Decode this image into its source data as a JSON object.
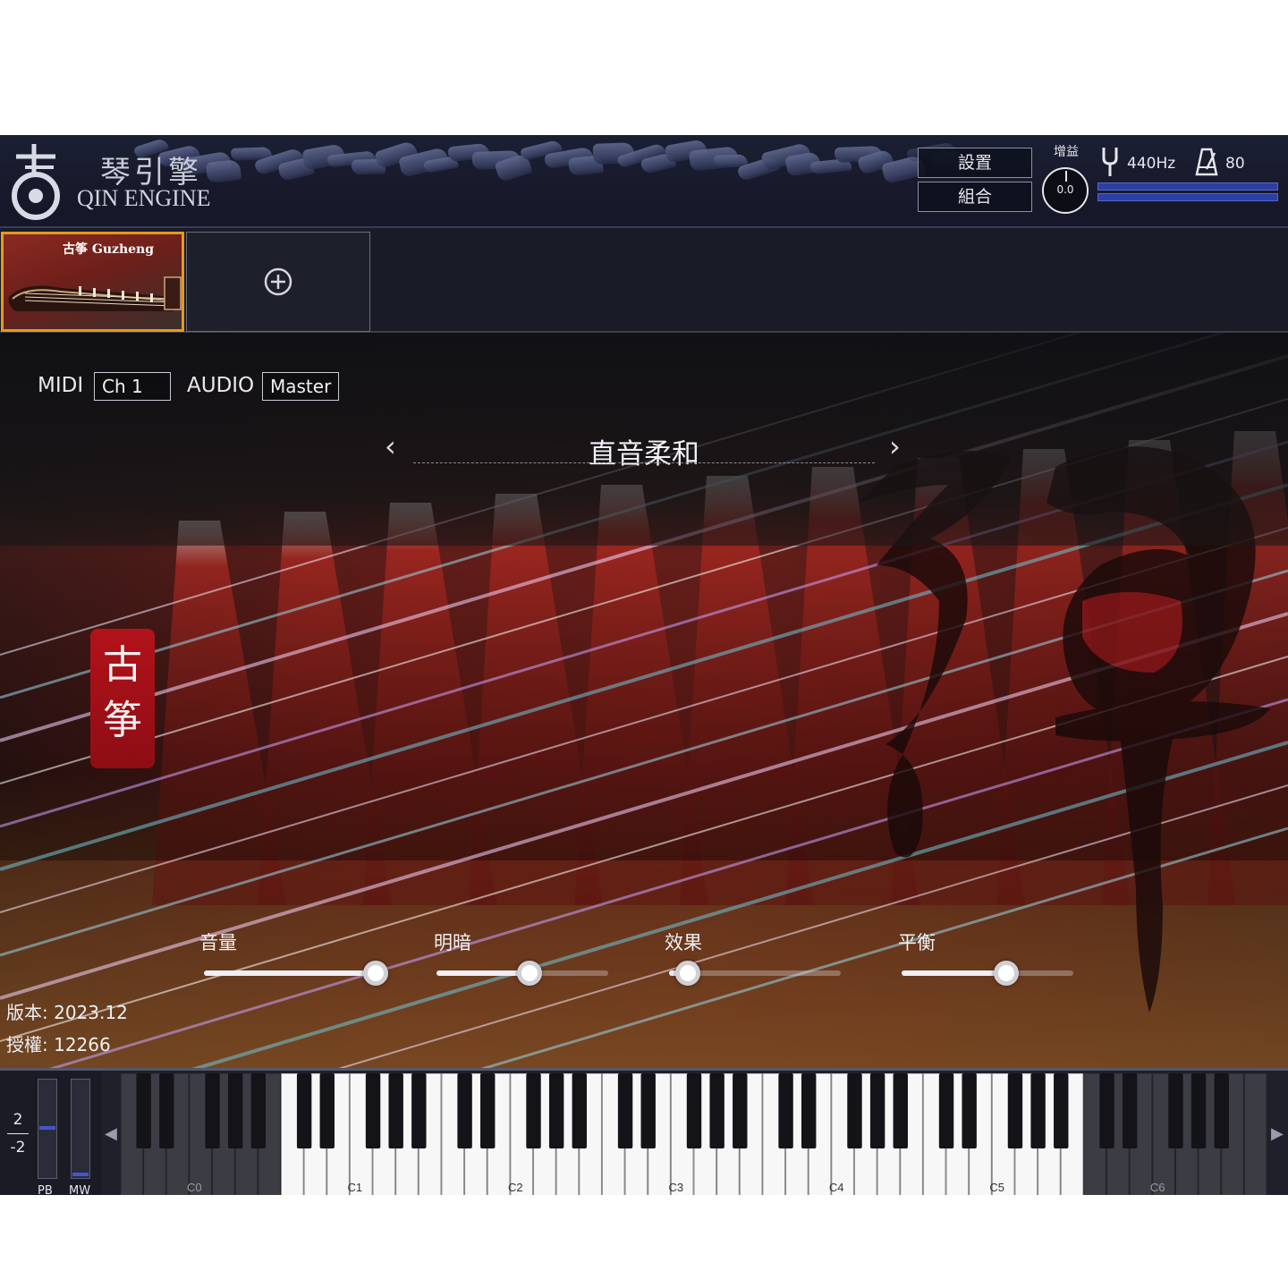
{
  "header": {
    "brand_cn": "琴引擎",
    "brand_en": "QIN ENGINE",
    "settings_label": "設置",
    "combo_label": "組合",
    "gain_label": "增益",
    "gain_value": "0.0",
    "tuning_value": "440Hz",
    "tempo_value": "80",
    "icons": [
      "logo-icon",
      "tuning-fork-icon",
      "metronome-icon"
    ]
  },
  "slots": {
    "active_title": "古筝 Guzheng",
    "add_icon": "plus-circle-icon"
  },
  "routing": {
    "midi_label": "MIDI",
    "midi_channel": "Ch 1",
    "audio_label": "AUDIO",
    "audio_out": "Master"
  },
  "preset": {
    "name": "直音柔和",
    "prev": "‹",
    "next": "›"
  },
  "badge_text": "古筝",
  "controls": [
    {
      "label": "音量",
      "value": 1.0
    },
    {
      "label": "明暗",
      "value": 0.54
    },
    {
      "label": "效果",
      "value": 0.11
    },
    {
      "label": "平衡",
      "value": 0.61
    }
  ],
  "info": {
    "version": "版本: 2023.12",
    "license": "授權: 12266"
  },
  "keyboard": {
    "pb_up": "2",
    "pb_down": "-2",
    "pb_label": "PB",
    "mw_label": "MW",
    "octave_labels": [
      "C0",
      "C1",
      "C2",
      "C3",
      "C4",
      "C5",
      "C6"
    ],
    "active_range": [
      "C1",
      "C5"
    ],
    "scroll_left": "◀",
    "scroll_right": "▶"
  },
  "colors": {
    "accent_orange": "#e39a1e",
    "badge_red": "#b3121a",
    "meter_blue": "#2e3fa3"
  }
}
